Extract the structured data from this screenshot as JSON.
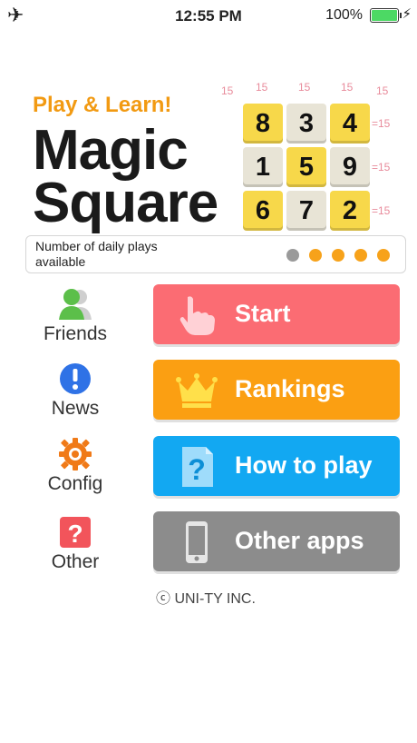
{
  "status": {
    "time": "12:55 PM",
    "battery": "100%"
  },
  "header": {
    "subtitle": "Play & Learn!",
    "title_line1": "Magic",
    "title_line2": "Square"
  },
  "grid": {
    "rows": [
      [
        "8",
        "3",
        "4"
      ],
      [
        "1",
        "5",
        "9"
      ],
      [
        "6",
        "7",
        "2"
      ]
    ],
    "sum": "15",
    "sum_right": "=15"
  },
  "plays": {
    "label": "Number of daily plays available",
    "total": 5,
    "available": 4
  },
  "side_menu": [
    {
      "label": "Friends",
      "icon": "friends-icon"
    },
    {
      "label": "News",
      "icon": "info-icon"
    },
    {
      "label": "Config",
      "icon": "gear-icon"
    },
    {
      "label": "Other",
      "icon": "question-icon"
    }
  ],
  "buttons": {
    "start": "Start",
    "rankings": "Rankings",
    "how_to_play": "How to play",
    "other_apps": "Other apps"
  },
  "footer": {
    "copyright": "ⓒ UNI-TY INC."
  },
  "colors": {
    "start": "#fb6c73",
    "rankings": "#fb9f12",
    "how": "#12a8f2",
    "other": "#8c8c8c",
    "accent": "#f29a12"
  }
}
